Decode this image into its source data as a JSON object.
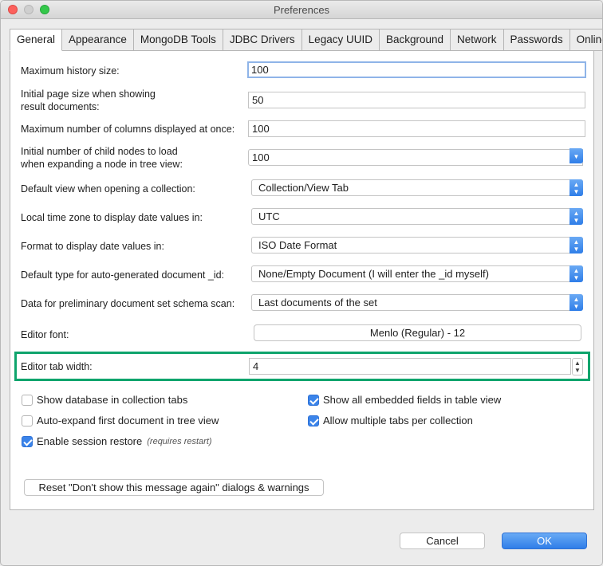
{
  "window": {
    "title": "Preferences"
  },
  "tabs": [
    {
      "label": "General"
    },
    {
      "label": "Appearance"
    },
    {
      "label": "MongoDB Tools"
    },
    {
      "label": "JDBC Drivers"
    },
    {
      "label": "Legacy UUID"
    },
    {
      "label": "Background"
    },
    {
      "label": "Network"
    },
    {
      "label": "Passwords"
    },
    {
      "label": "Online"
    }
  ],
  "settings": {
    "history": {
      "label": "Maximum history size:",
      "value": "100"
    },
    "page_size": {
      "label_line1": "Initial page size when showing",
      "label_line2": "result documents:",
      "value": "50"
    },
    "max_columns": {
      "label": "Maximum number of columns displayed at once:",
      "value": "100"
    },
    "child_nodes": {
      "label_line1": "Initial number of child nodes to load",
      "label_line2": "when expanding a node in tree view:",
      "value": "100"
    },
    "default_view": {
      "label": "Default view when opening a collection:",
      "value": "Collection/View Tab"
    },
    "time_zone": {
      "label": "Local time zone to display date values in:",
      "value": "UTC"
    },
    "date_format": {
      "label": "Format to display date values in:",
      "value": "ISO Date Format"
    },
    "id_type": {
      "label": "Default type for auto-generated document _id:",
      "value": "None/Empty Document (I will enter the _id myself)"
    },
    "schema_scan": {
      "label": "Data for preliminary document set schema scan:",
      "value": "Last documents of the set"
    },
    "editor_font": {
      "label": "Editor font:",
      "value": "Menlo (Regular) - 12"
    },
    "tab_width": {
      "label": "Editor tab width:",
      "value": "4"
    }
  },
  "checkboxes": {
    "show_db": {
      "label": "Show database in collection tabs",
      "checked": false
    },
    "auto_expand": {
      "label": "Auto-expand first document in tree view",
      "checked": false
    },
    "session_restore": {
      "label": "Enable session restore",
      "note": "(requires restart)",
      "checked": true
    },
    "embedded_fields": {
      "label": "Show all embedded fields in table view",
      "checked": true
    },
    "multiple_tabs": {
      "label": "Allow multiple tabs per collection",
      "checked": true
    }
  },
  "reset_label": "Reset \"Don't show this message again\" dialogs & warnings",
  "footer": {
    "cancel": "Cancel",
    "ok": "OK"
  },
  "colors": {
    "accent": "#3b84ea",
    "highlight": "#0ea46c"
  }
}
